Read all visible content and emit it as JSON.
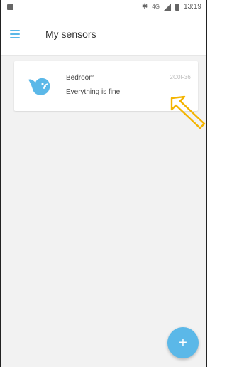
{
  "status_bar": {
    "time": "13:19",
    "network_label": "4G",
    "icons": [
      "notification-icon",
      "bluetooth-icon",
      "network-icon",
      "signal-icon",
      "battery-icon"
    ]
  },
  "app_bar": {
    "title": "My sensors",
    "menu_icon": "hamburger-menu-icon"
  },
  "sensors": [
    {
      "name": "Bedroom",
      "status": "Everything is fine!",
      "id": "2C0F36",
      "icon": "bird-wifi-icon"
    }
  ],
  "fab": {
    "label": "+",
    "icon": "add-icon"
  },
  "colors": {
    "accent": "#5bb8e8",
    "background": "#f2f2f2",
    "card": "#ffffff",
    "annotation_arrow": "#f4b400"
  }
}
